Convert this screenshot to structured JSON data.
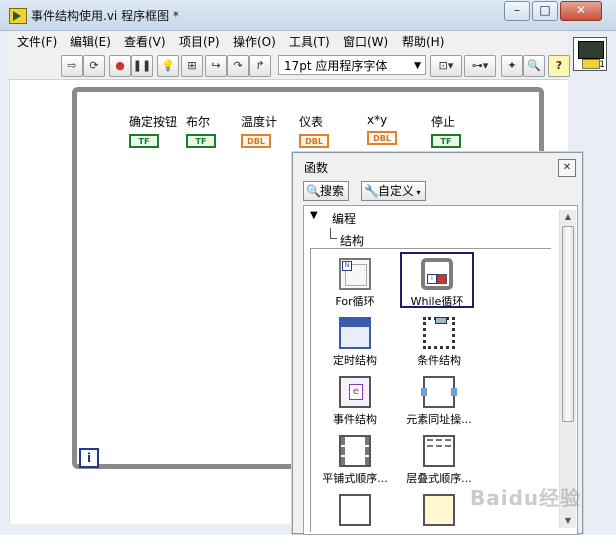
{
  "window": {
    "title": "事件结构使用.vi 程序框图 *",
    "buttons": [
      "–",
      "□",
      "✕"
    ]
  },
  "menu": [
    "文件(F)",
    "编辑(E)",
    "查看(V)",
    "项目(P)",
    "操作(O)",
    "工具(T)",
    "窗口(W)",
    "帮助(H)"
  ],
  "toolbar": {
    "font_select": "17pt 应用程序字体"
  },
  "context_help": {
    "label": "1"
  },
  "terminals": [
    {
      "label": "确定按钮",
      "type": "TF"
    },
    {
      "label": "布尔",
      "type": "TF"
    },
    {
      "label": "温度计",
      "type": "DBL"
    },
    {
      "label": "仪表",
      "type": "DBL"
    },
    {
      "label": "x*y",
      "type": "DBL"
    },
    {
      "label": "停止",
      "type": "TF"
    }
  ],
  "iteration_terminal": "i",
  "palette": {
    "title": "函数",
    "close": "✕",
    "search_button": "搜索",
    "customize_button": "自定义",
    "tree": {
      "category": "编程",
      "subcategory": "结构"
    },
    "items": [
      {
        "label": "For循环",
        "icon": "for-loop-icon"
      },
      {
        "label": "While循环",
        "icon": "while-loop-icon"
      },
      {
        "label": "定时结构",
        "icon": "timed-structure-icon"
      },
      {
        "label": "条件结构",
        "icon": "case-structure-icon"
      },
      {
        "label": "事件结构",
        "icon": "event-structure-icon"
      },
      {
        "label": "元素同址操...",
        "icon": "in-place-element-icon"
      },
      {
        "label": "平铺式顺序...",
        "icon": "flat-sequence-icon"
      },
      {
        "label": "层叠式顺序...",
        "icon": "stacked-sequence-icon"
      },
      {
        "label": "",
        "icon": "formula-node-icon"
      },
      {
        "label": "",
        "icon": "mathscript-node-icon"
      }
    ]
  },
  "watermark": "Baidu经验"
}
